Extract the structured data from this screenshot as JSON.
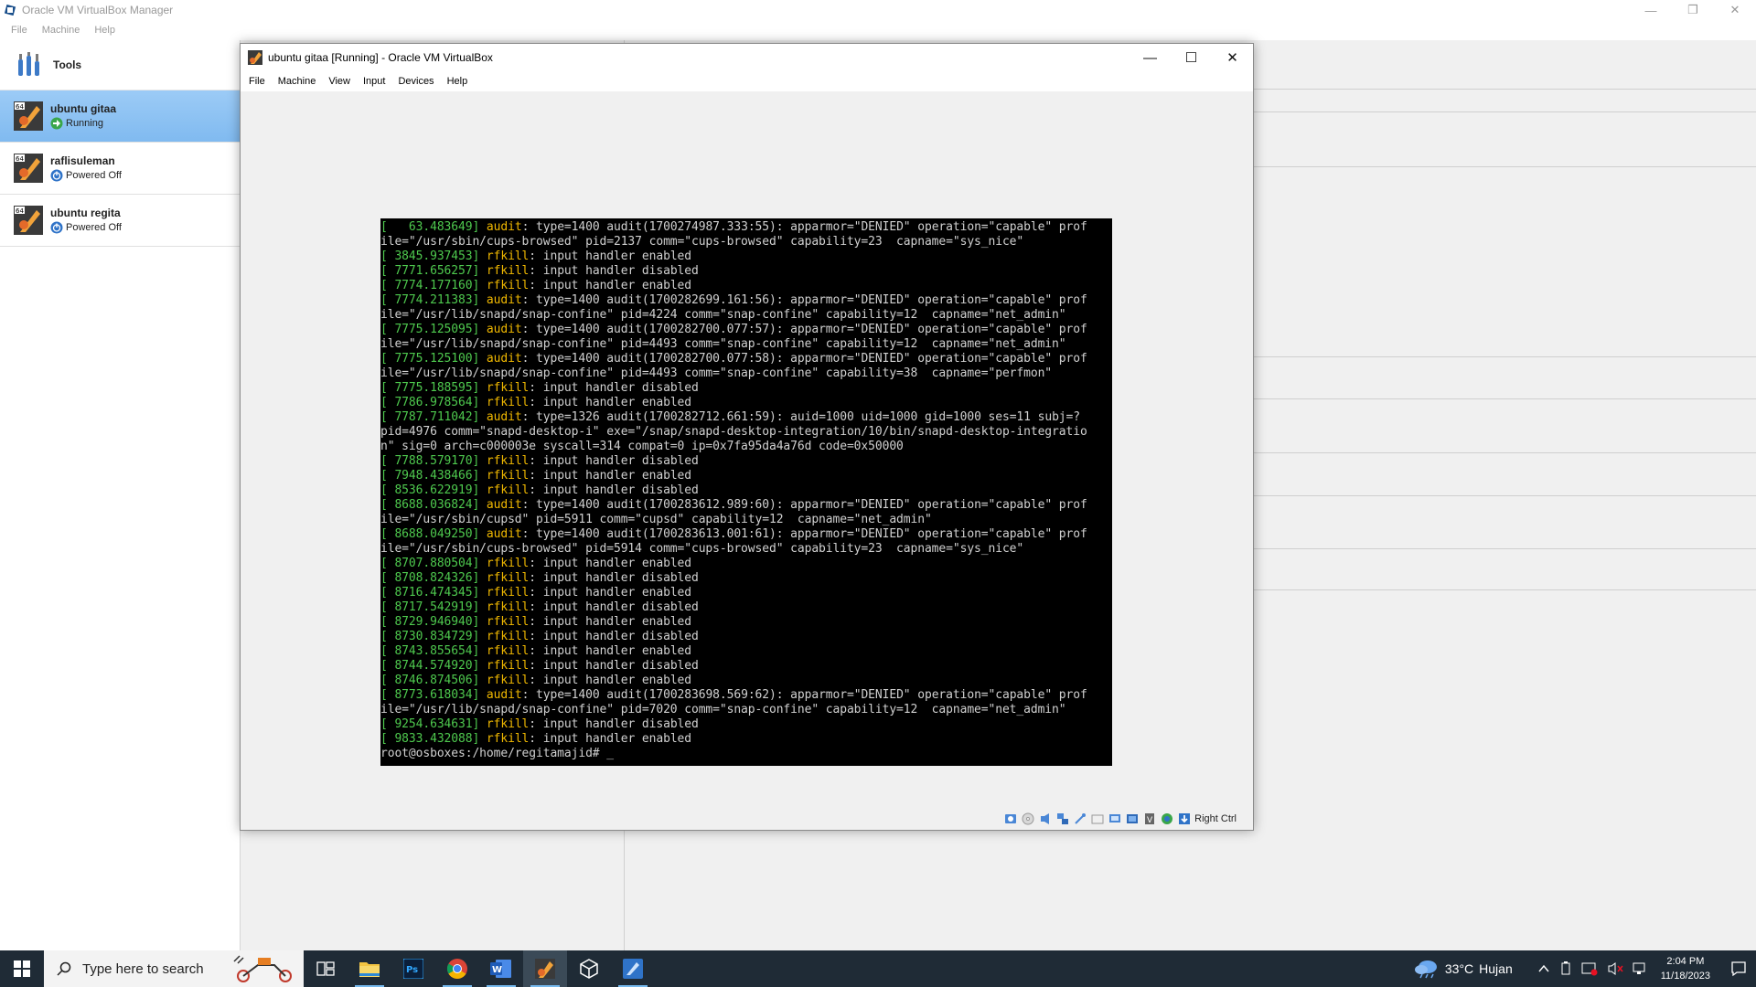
{
  "manager": {
    "title": "Oracle VM VirtualBox Manager",
    "menu": [
      "File",
      "Machine",
      "Help"
    ],
    "tools_label": "Tools",
    "vms": [
      {
        "name": "ubuntu gitaa",
        "state": "Running"
      },
      {
        "name": "raflisuleman",
        "state": "Powered Off"
      },
      {
        "name": "ubuntu regita",
        "state": "Powered Off"
      }
    ]
  },
  "vm_window": {
    "title": "ubuntu gitaa [Running] - Oracle VM VirtualBox",
    "menu": [
      "File",
      "Machine",
      "View",
      "Input",
      "Devices",
      "Help"
    ],
    "host_key": "Right Ctrl"
  },
  "console_lines": [
    {
      "ts": "[   63.483649]",
      "tag": "audit",
      "text": ": type=1400 audit(1700274987.333:55): apparmor=\"DENIED\" operation=\"capable\" prof"
    },
    {
      "ts": "",
      "tag": "",
      "text": "ile=\"/usr/sbin/cups-browsed\" pid=2137 comm=\"cups-browsed\" capability=23  capname=\"sys_nice\""
    },
    {
      "ts": "[ 3845.937453]",
      "tag": "rfkill",
      "text": ": input handler enabled"
    },
    {
      "ts": "[ 7771.656257]",
      "tag": "rfkill",
      "text": ": input handler disabled"
    },
    {
      "ts": "[ 7774.177160]",
      "tag": "rfkill",
      "text": ": input handler enabled"
    },
    {
      "ts": "[ 7774.211383]",
      "tag": "audit",
      "text": ": type=1400 audit(1700282699.161:56): apparmor=\"DENIED\" operation=\"capable\" prof"
    },
    {
      "ts": "",
      "tag": "",
      "text": "ile=\"/usr/lib/snapd/snap-confine\" pid=4224 comm=\"snap-confine\" capability=12  capname=\"net_admin\""
    },
    {
      "ts": "[ 7775.125095]",
      "tag": "audit",
      "text": ": type=1400 audit(1700282700.077:57): apparmor=\"DENIED\" operation=\"capable\" prof"
    },
    {
      "ts": "",
      "tag": "",
      "text": "ile=\"/usr/lib/snapd/snap-confine\" pid=4493 comm=\"snap-confine\" capability=12  capname=\"net_admin\""
    },
    {
      "ts": "[ 7775.125100]",
      "tag": "audit",
      "text": ": type=1400 audit(1700282700.077:58): apparmor=\"DENIED\" operation=\"capable\" prof"
    },
    {
      "ts": "",
      "tag": "",
      "text": "ile=\"/usr/lib/snapd/snap-confine\" pid=4493 comm=\"snap-confine\" capability=38  capname=\"perfmon\""
    },
    {
      "ts": "[ 7775.188595]",
      "tag": "rfkill",
      "text": ": input handler disabled"
    },
    {
      "ts": "[ 7786.978564]",
      "tag": "rfkill",
      "text": ": input handler enabled"
    },
    {
      "ts": "[ 7787.711042]",
      "tag": "audit",
      "text": ": type=1326 audit(1700282712.661:59): auid=1000 uid=1000 gid=1000 ses=11 subj=?"
    },
    {
      "ts": "",
      "tag": "",
      "text": "pid=4976 comm=\"snapd-desktop-i\" exe=\"/snap/snapd-desktop-integration/10/bin/snapd-desktop-integratio"
    },
    {
      "ts": "",
      "tag": "",
      "text": "n\" sig=0 arch=c000003e syscall=314 compat=0 ip=0x7fa95da4a76d code=0x50000"
    },
    {
      "ts": "[ 7788.579170]",
      "tag": "rfkill",
      "text": ": input handler disabled"
    },
    {
      "ts": "[ 7948.438466]",
      "tag": "rfkill",
      "text": ": input handler enabled"
    },
    {
      "ts": "[ 8536.622919]",
      "tag": "rfkill",
      "text": ": input handler disabled"
    },
    {
      "ts": "[ 8688.036824]",
      "tag": "audit",
      "text": ": type=1400 audit(1700283612.989:60): apparmor=\"DENIED\" operation=\"capable\" prof"
    },
    {
      "ts": "",
      "tag": "",
      "text": "ile=\"/usr/sbin/cupsd\" pid=5911 comm=\"cupsd\" capability=12  capname=\"net_admin\""
    },
    {
      "ts": "[ 8688.049250]",
      "tag": "audit",
      "text": ": type=1400 audit(1700283613.001:61): apparmor=\"DENIED\" operation=\"capable\" prof"
    },
    {
      "ts": "",
      "tag": "",
      "text": "ile=\"/usr/sbin/cups-browsed\" pid=5914 comm=\"cups-browsed\" capability=23  capname=\"sys_nice\""
    },
    {
      "ts": "[ 8707.880504]",
      "tag": "rfkill",
      "text": ": input handler enabled"
    },
    {
      "ts": "[ 8708.824326]",
      "tag": "rfkill",
      "text": ": input handler disabled"
    },
    {
      "ts": "[ 8716.474345]",
      "tag": "rfkill",
      "text": ": input handler enabled"
    },
    {
      "ts": "[ 8717.542919]",
      "tag": "rfkill",
      "text": ": input handler disabled"
    },
    {
      "ts": "[ 8729.946940]",
      "tag": "rfkill",
      "text": ": input handler enabled"
    },
    {
      "ts": "[ 8730.834729]",
      "tag": "rfkill",
      "text": ": input handler disabled"
    },
    {
      "ts": "[ 8743.855654]",
      "tag": "rfkill",
      "text": ": input handler enabled"
    },
    {
      "ts": "[ 8744.574920]",
      "tag": "rfkill",
      "text": ": input handler disabled"
    },
    {
      "ts": "[ 8746.874506]",
      "tag": "rfkill",
      "text": ": input handler enabled"
    },
    {
      "ts": "[ 8773.618034]",
      "tag": "audit",
      "text": ": type=1400 audit(1700283698.569:62): apparmor=\"DENIED\" operation=\"capable\" prof"
    },
    {
      "ts": "",
      "tag": "",
      "text": "ile=\"/usr/lib/snapd/snap-confine\" pid=7020 comm=\"snap-confine\" capability=12  capname=\"net_admin\""
    },
    {
      "ts": "[ 9254.634631]",
      "tag": "rfkill",
      "text": ": input handler disabled"
    },
    {
      "ts": "[ 9833.432088]",
      "tag": "rfkill",
      "text": ": input handler enabled"
    },
    {
      "ts": "",
      "tag": "",
      "text": "root@osboxes:/home/regitamajid# _"
    }
  ],
  "taskbar": {
    "search_placeholder": "Type here to search",
    "apps": [
      "task-view-icon",
      "file-explorer-icon",
      "photoshop-icon",
      "chrome-icon",
      "word-icon",
      "virtualbox-vm-icon",
      "virtualbox-icon",
      "virtualbox-manager-icon"
    ],
    "weather_temp": "33°C",
    "weather_desc": "Hujan",
    "time": "2:04 PM",
    "date": "11/18/2023"
  },
  "colors": {
    "selection": "#99ccff",
    "console_bg": "#000000",
    "timestamp_green": "#4ec94e",
    "tag_yellow": "#f0b800",
    "taskbar_bg": "#1f2b36"
  }
}
